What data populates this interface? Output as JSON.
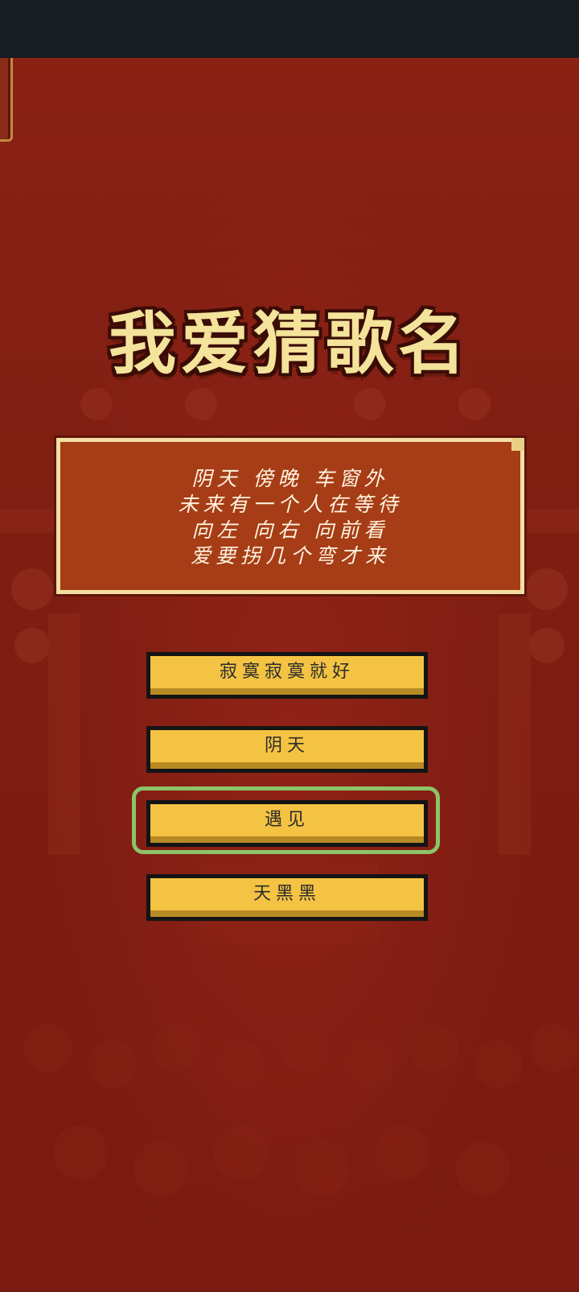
{
  "game": {
    "title": "我爱猜歌名",
    "lyrics": [
      "阴天 傍晚 车窗外",
      "未来有一个人在等待",
      "向左 向右 向前看",
      "爱要拐几个弯才来"
    ],
    "options": [
      {
        "label": "寂寞寂寞就好",
        "selected": false
      },
      {
        "label": "阴天",
        "selected": false
      },
      {
        "label": "遇见",
        "selected": true
      },
      {
        "label": "天黑黑",
        "selected": false
      }
    ],
    "colors": {
      "background": "#7d1d12",
      "title": "#f4e39a",
      "panel": "#a63d16",
      "button": "#f4c343",
      "highlight": "#8cc46a"
    },
    "icons": {
      "back": "back-tab-icon"
    }
  }
}
